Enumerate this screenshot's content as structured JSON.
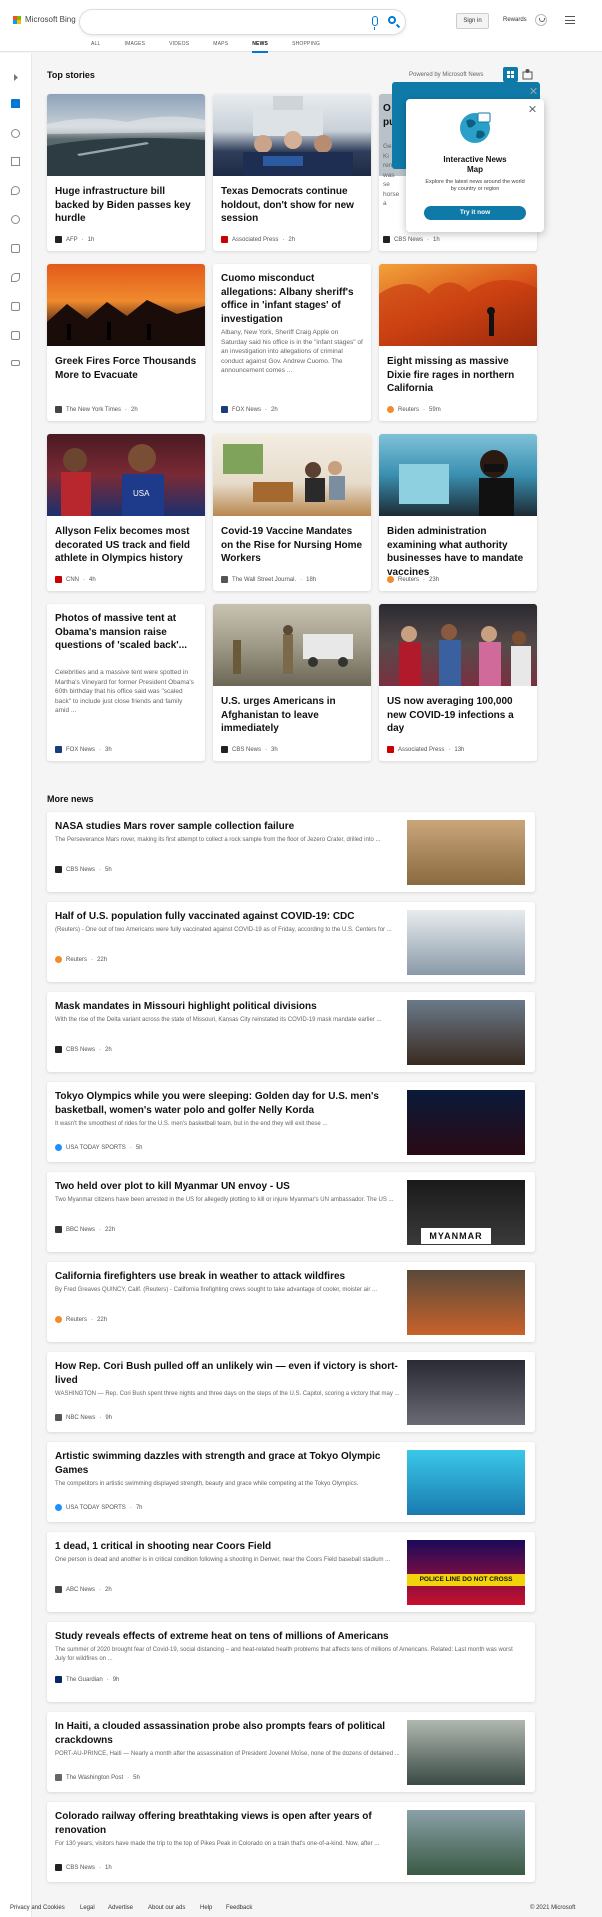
{
  "header": {
    "brand": "Microsoft Bing",
    "signin": "Sign in",
    "rewards": "Rewards",
    "tabs": [
      "ALL",
      "IMAGES",
      "VIDEOS",
      "MAPS",
      "NEWS",
      "SHOPPING"
    ],
    "active_tab": "NEWS"
  },
  "colors": {
    "accent": "#0078d4",
    "teal": "#0f7aa8"
  },
  "sidebar": {
    "icons": [
      "expand-icon",
      "home-icon",
      "recommended-icon",
      "flag-icon",
      "location-icon",
      "world-icon",
      "business-icon",
      "science-icon",
      "entertainment-icon",
      "politics-icon",
      "money-icon"
    ]
  },
  "top": {
    "title": "Top stories",
    "powered": "Powered by Microsoft News",
    "cards": [
      {
        "title": "Huge infrastructure bill backed by Biden passes key hurdle",
        "source": "AFP",
        "time": "1h"
      },
      {
        "title": "Texas Democrats continue holdout, don't show for new session",
        "source": "Associated Press",
        "time": "2h"
      },
      {
        "title": "Greek Fires Force Thousands More to Evacuate",
        "source": "The New York Times",
        "time": "2h"
      },
      {
        "title": "Cuomo misconduct allegations: Albany sheriff's office in 'infant stages' of investigation",
        "abstract": "Albany, New York, Sheriff Craig Apple on Saturday said his office is in the \"infant stages\" of an investigation into allegations of criminal conduct against Gov. Andrew Cuomo. The announcement comes ...",
        "source": "FOX News",
        "time": "2h"
      },
      {
        "title": "Eight missing as massive Dixie fire rages in northern California",
        "source": "Reuters",
        "time": "59m"
      },
      {
        "title": "Allyson Felix becomes most decorated US track and field athlete in Olympics history",
        "source": "CNN",
        "time": "4h"
      },
      {
        "title": "Covid-19 Vaccine Mandates on the Rise for Nursing Home Workers",
        "source": "The Wall Street Journal.",
        "time": "18h"
      },
      {
        "title": "Biden administration examining what authority businesses have to mandate vaccines",
        "source": "Reuters",
        "time": "23h"
      },
      {
        "title": "Photos of massive tent at Obama's mansion raise questions of 'scaled back'...",
        "abstract": "Celebrities and a massive tent were spotted in Martha's Vineyard for former President Obama's 60th birthday that his office said was \"scaled back\" to include just close friends and family amid ...",
        "source": "FOX News",
        "time": "3h"
      },
      {
        "title": "U.S. urges Americans in Afghanistan to leave immediately",
        "source": "CBS News",
        "time": "3h"
      },
      {
        "title": "US now averaging 100,000 new COVID-19 infections a day",
        "source": "Associated Press",
        "time": "13h"
      }
    ],
    "partial_card": {
      "title_start": "O",
      "title_line2": "pu",
      "abstract": "Ge Ki rem was se horse a",
      "source": "CBS News",
      "time": "1h"
    }
  },
  "popup": {
    "title_l1": "Interactive News",
    "title_l2": "Map",
    "desc": "Explore the latest news around the world by country or region",
    "button": "Try it now"
  },
  "more": {
    "title": "More news",
    "items": [
      {
        "title": "NASA studies Mars rover sample collection failure",
        "abstract": "The Perseverance Mars rover, making its first attempt to collect a rock sample from the floor of Jezero Crater, drilled into ...",
        "source": "CBS News",
        "time": "5h"
      },
      {
        "title": "Half of U.S. population fully vaccinated against COVID-19: CDC",
        "abstract": "(Reuters) - One out of two Americans were fully vaccinated against COVID-19 as of Friday, according to the U.S. Centers for ...",
        "source": "Reuters",
        "time": "22h"
      },
      {
        "title": "Mask mandates in Missouri highlight political divisions",
        "abstract": "With the rise of the Delta variant across the state of Missouri, Kansas City reinstated its COVID-19 mask mandate earlier ...",
        "source": "CBS News",
        "time": "2h"
      },
      {
        "title": "Tokyo Olympics while you were sleeping: Golden day for U.S. men's basketball, women's water polo and golfer Nelly Korda",
        "abstract": "It wasn't the smoothest of rides for the U.S. men's basketball team, but in the end they will exit these ...",
        "source": "USA TODAY SPORTS",
        "time": "5h"
      },
      {
        "title": "Two held over plot to kill Myanmar UN envoy - US",
        "abstract": "Two Myanmar citizens have been arrested in the US for allegedly plotting to kill or injure Myanmar's UN ambassador. The US ...",
        "source": "BBC News",
        "time": "22h",
        "thumb_text": "MYANMAR"
      },
      {
        "title": "California firefighters use break in weather to attack wildfires",
        "abstract": "By Fred Greaves QUINCY, Calif. (Reuters) - California firefighting crews sought to take advantage of cooler, moister air ...",
        "source": "Reuters",
        "time": "22h"
      },
      {
        "title": "How Rep. Cori Bush pulled off an unlikely win — even if victory is short-lived",
        "abstract": "WASHINGTON — Rep. Cori Bush spent three nights and three days on the steps of the U.S. Capitol, scoring a victory that may ...",
        "source": "NBC News",
        "time": "9h"
      },
      {
        "title": "Artistic swimming dazzles with strength and grace at Tokyo Olympic Games",
        "abstract": "The competitors in artistic swimming displayed strength, beauty and grace while competing at the Tokyo Olympics.",
        "source": "USA TODAY SPORTS",
        "time": "7h"
      },
      {
        "title": "1 dead, 1 critical in shooting near Coors Field",
        "abstract": "One person is dead and another is in critical condition following a shooting in Denver, near the Coors Field baseball stadium ...",
        "source": "ABC News",
        "time": "2h",
        "thumb_text": "POLICE LINE DO NOT CROSS"
      },
      {
        "title": "Study reveals effects of extreme heat on tens of millions of Americans",
        "abstract": "The summer of 2020 brought fear of Covid-19, social distancing – and heat-related health problems that affects tens of millions of Americans. Related: Last month was worst July for wildfires on ...",
        "source": "The Guardian",
        "time": "9h"
      },
      {
        "title": "In Haiti, a clouded assassination probe also prompts fears of political crackdowns",
        "abstract": "PORT-AU-PRINCE, Haiti — Nearly a month after the assassination of President Jovenel Moïse, none of the dozens of detained ...",
        "source": "The Washington Post",
        "time": "5h"
      },
      {
        "title": "Colorado railway offering breathtaking views is open after years of renovation",
        "abstract": "For 130 years, visitors have made the trip to the top of Pikes Peak in Colorado on a train that's one-of-a-kind. Now, after ...",
        "source": "CBS News",
        "time": "1h"
      }
    ]
  },
  "footer": {
    "links": [
      "Privacy and Cookies",
      "Legal",
      "Advertise",
      "About our ads",
      "Help",
      "Feedback"
    ],
    "copyright": "© 2021 Microsoft"
  }
}
